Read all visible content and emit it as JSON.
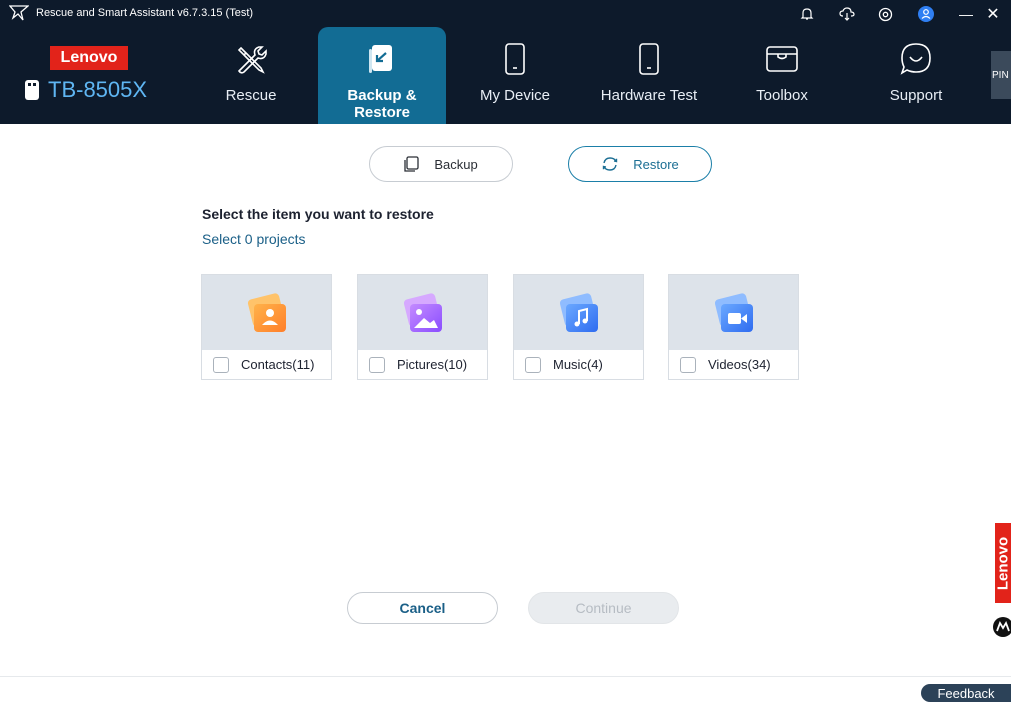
{
  "window": {
    "title": "Rescue and Smart Assistant v6.7.3.15 (Test)",
    "controls": [
      "bell-icon",
      "cloud-download-icon",
      "settings-icon",
      "user-icon",
      "minimize-icon",
      "close-icon"
    ],
    "minimize": "—",
    "close": "✕"
  },
  "brand": {
    "logo_text": "Lenovo",
    "device_name": "TB-8505X",
    "accent": "#e2231a"
  },
  "nav": {
    "items": [
      {
        "label": "Rescue",
        "icon": "tools-icon"
      },
      {
        "label": "Backup & Restore",
        "icon": "backup-restore-icon",
        "active": true
      },
      {
        "label": "My Device",
        "icon": "tablet-icon"
      },
      {
        "label": "Hardware Test",
        "icon": "tablet-icon"
      },
      {
        "label": "Toolbox",
        "icon": "toolbox-icon"
      },
      {
        "label": "Support",
        "icon": "chat-icon"
      }
    ],
    "pin_label": "PIN"
  },
  "mode": {
    "backup_label": "Backup",
    "restore_label": "Restore",
    "selected": "Restore"
  },
  "restore": {
    "title": "Select the item you want to restore",
    "subtitle": "Select 0 projects",
    "items": [
      {
        "label": "Contacts(11)",
        "icon": "contacts-icon",
        "checked": false
      },
      {
        "label": "Pictures(10)",
        "icon": "pictures-icon",
        "checked": false
      },
      {
        "label": "Music(4)",
        "icon": "music-icon",
        "checked": false
      },
      {
        "label": "Videos(34)",
        "icon": "videos-icon",
        "checked": false
      }
    ]
  },
  "actions": {
    "cancel_label": "Cancel",
    "continue_label": "Continue"
  },
  "footer": {
    "feedback_label": "Feedback",
    "side_brand": "Lenovo"
  },
  "colors": {
    "nav_bg": "#0d1a2b",
    "active_tab": "#126c94",
    "link_blue": "#1a5f87"
  }
}
